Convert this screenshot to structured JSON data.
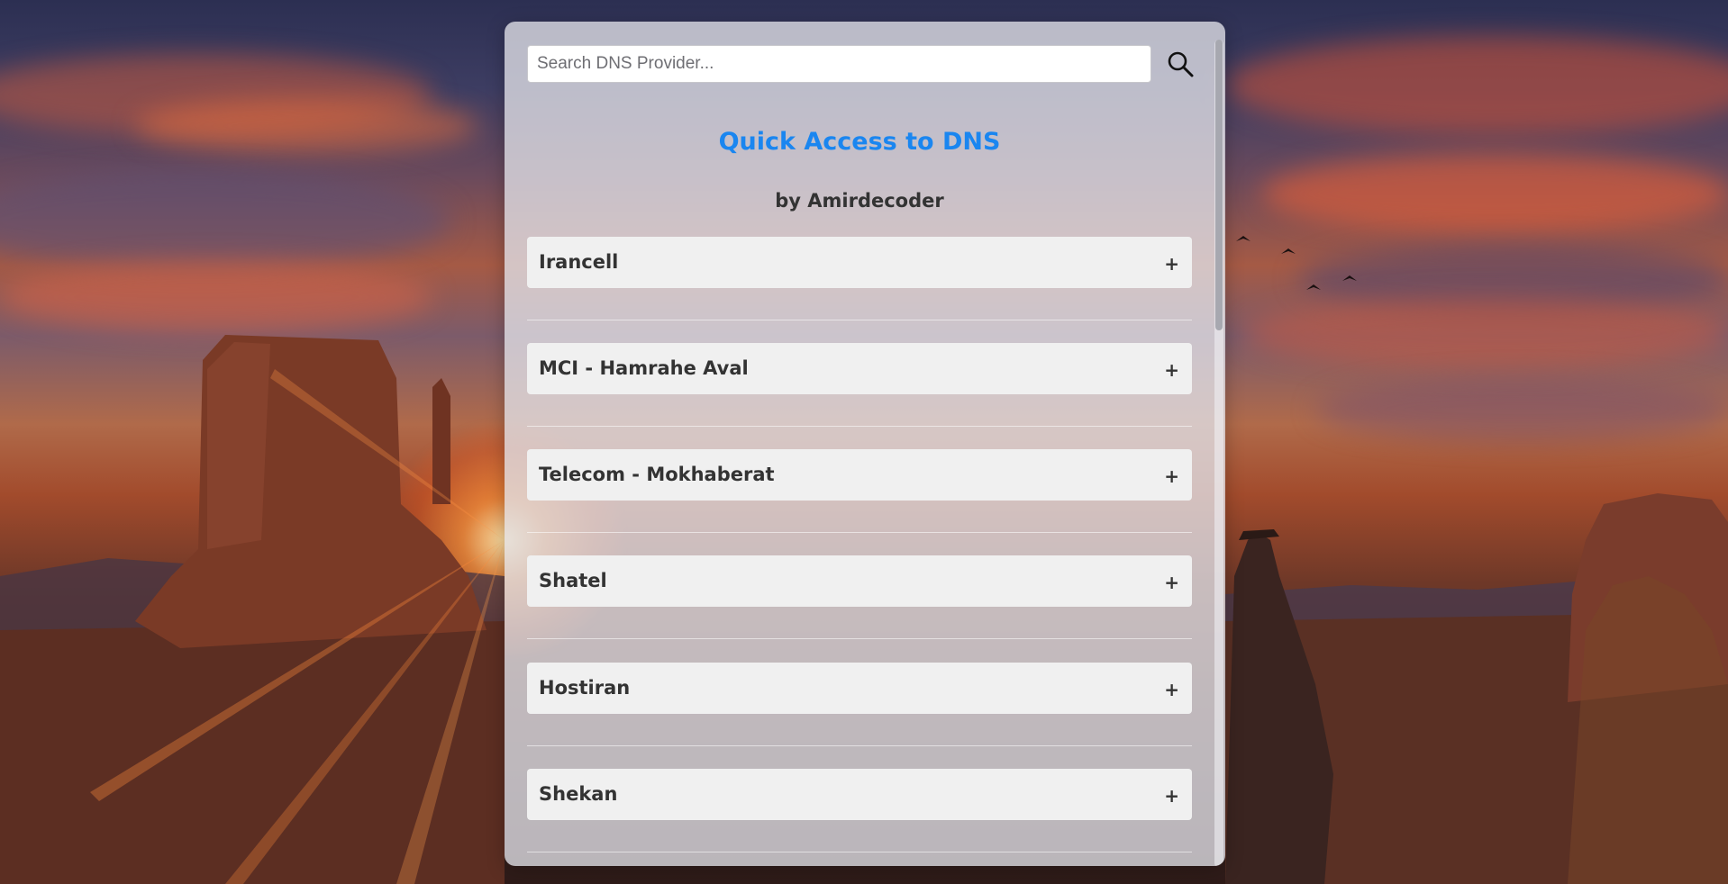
{
  "search": {
    "placeholder": "Search DNS Provider...",
    "icon": "search-icon"
  },
  "header": {
    "title": "Quick Access to DNS",
    "subtitle": "by Amirdecoder"
  },
  "providers": [
    {
      "label": "Irancell",
      "toggle": "+"
    },
    {
      "label": "MCI - Hamrahe Aval",
      "toggle": "+"
    },
    {
      "label": "Telecom - Mokhaberat",
      "toggle": "+"
    },
    {
      "label": "Shatel",
      "toggle": "+"
    },
    {
      "label": "Hostiran",
      "toggle": "+"
    },
    {
      "label": "Shekan",
      "toggle": "+"
    },
    {
      "label": "",
      "toggle": ""
    }
  ],
  "colors": {
    "title": "#1a86f0",
    "text": "#333333",
    "item_bg": "#f0f0f0",
    "panel_bg": "rgba(225,225,232,0.78)"
  }
}
